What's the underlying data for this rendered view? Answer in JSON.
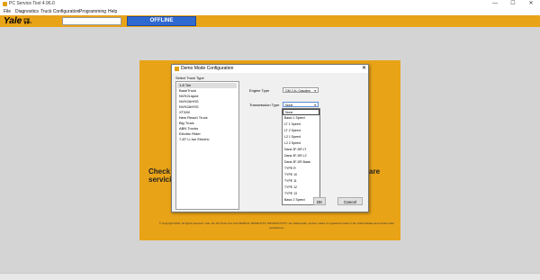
{
  "window": {
    "title": "PC Service Tool 4.96.0",
    "minimize": "—",
    "maximize": "☐",
    "close": "✕"
  },
  "menu": [
    {
      "label": "File"
    },
    {
      "label": "Diagnostics"
    },
    {
      "label": "Truck Configuration"
    },
    {
      "label": "Programming"
    },
    {
      "label": "Help"
    }
  ],
  "toolbar": {
    "logo": "Yale",
    "status": "OFFLINE",
    "input_value": ""
  },
  "panel": {
    "message_left": "Check yo",
    "message_right": "are",
    "message_line2": "servicing",
    "copyright": "© Copyright 2022. All rights reserved. Yale, the Lift Truck icon and PEOPLE. PRODUCTS. PRODUCTIVITY. are trademarks, service marks or registered marks in the United States and certain other jurisdictions."
  },
  "dialog": {
    "title": "Demo Mode Configuration",
    "close": "✕",
    "select_label": "Select Truck Type",
    "truck_types": [
      "1-8 Ton",
      "BaseTruck",
      "NVH2Liquid",
      "NVH2AHSS",
      "NVH2AHSS",
      "XT/MX",
      "New Reach Truck",
      "Big Truck",
      "ABN Trucks",
      "Electric Rider",
      "7-8T Li-Ion Electric"
    ],
    "selected_index": 0,
    "engine_label": "Engine Type",
    "engine_value": "GM 2.4L Gasoline",
    "transmission_label": "Transmission Type",
    "transmission_value": "None",
    "transmission_options": [
      "None",
      "Basic 1 Speed",
      "LT 1 Speed",
      "LT 2 Speed",
      "L2 1 Speed",
      "L2 2 Speed",
      "Dana 3F-DR LT",
      "Dana 3F-DR L2",
      "Dana 3F-DR Basic",
      "TYPE R",
      "TYPE 10",
      "TYPE 11",
      "TYPE 12",
      "TYPE 13",
      "Basic 2 Speed"
    ],
    "ok_label": "OK",
    "cancel_label": "Cancel"
  }
}
